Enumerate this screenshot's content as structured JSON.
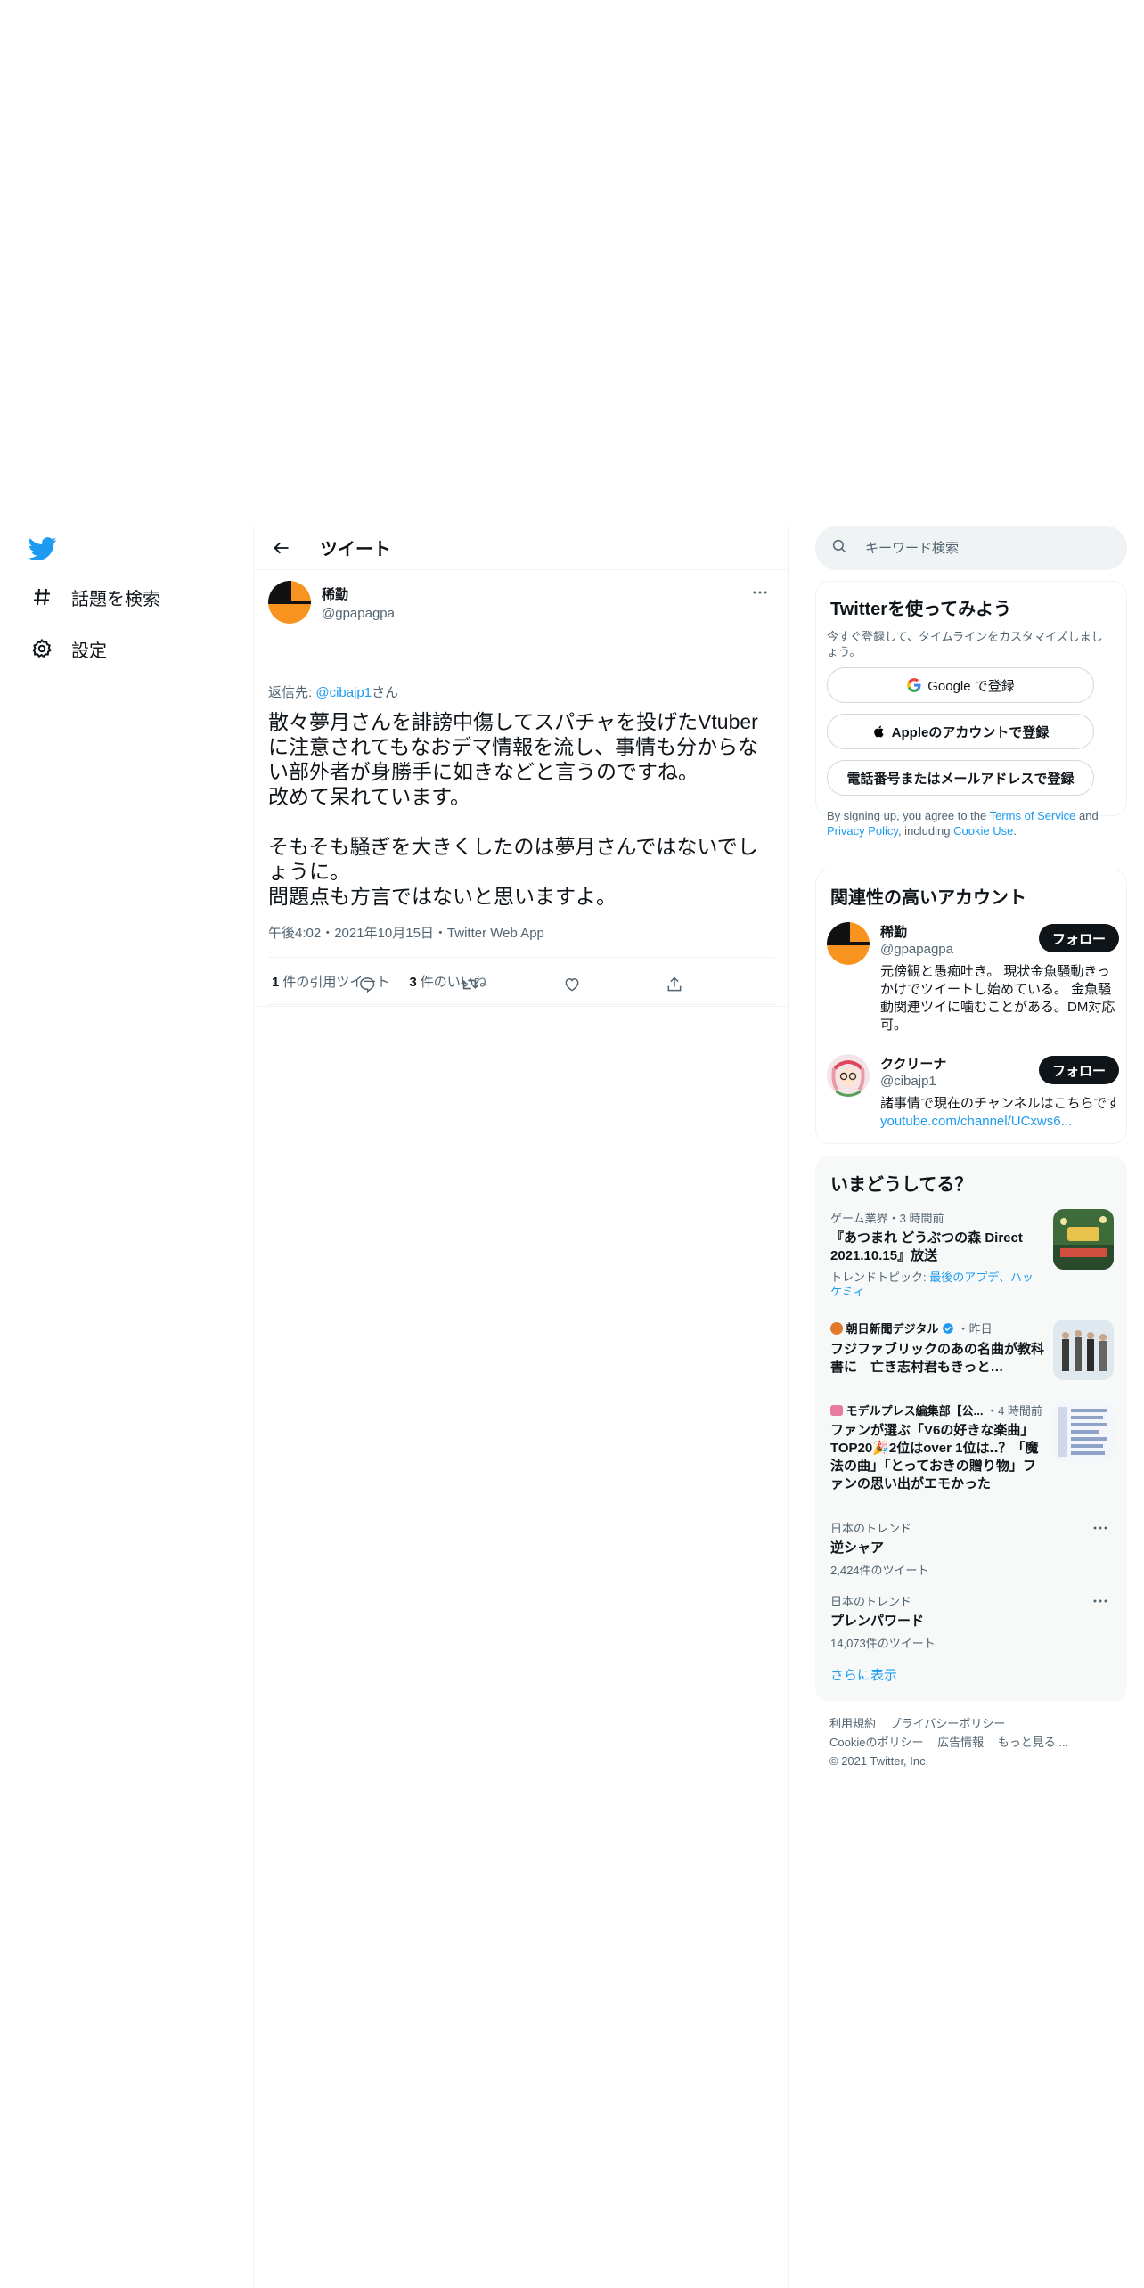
{
  "nav": {
    "items": [
      {
        "label": "話題を検索",
        "icon": "hashtag-icon"
      },
      {
        "label": "設定",
        "icon": "gear-icon"
      }
    ]
  },
  "header": {
    "title": "ツイート"
  },
  "tweet": {
    "name": "稀勤",
    "handle": "@gpapagpa",
    "reply_prefix": "返信先: ",
    "reply_to": "@cibajp1",
    "reply_suffix": "さん",
    "text": "散々夢月さんを誹謗中傷してスパチャを投げたVtuberに注意されてもなおデマ情報を流し、事情も分からない部外者が身勝手に如きなどと言うのですね。\n改めて呆れています。\n\nそもそも騒ぎを大きくしたのは夢月さんではないでしょうに。\n問題点も方言ではないと思いますよ。",
    "meta": "午後4:02・2021年10月15日・Twitter Web App",
    "quote_count": "1",
    "quote_label": "件の引用ツイート",
    "like_count": "3",
    "like_label": "件のいいね"
  },
  "search": {
    "placeholder": "キーワード検索"
  },
  "signup": {
    "title": "Twitterを使ってみよう",
    "subtitle": "今すぐ登録して、タイムラインをカスタマイズしましょう。",
    "google": "Google で登録",
    "apple": "Appleのアカウントで登録",
    "phone": "電話番号またはメールアドレスで登録",
    "legal_1": "By signing up, you agree to the ",
    "terms": "Terms of Service",
    "legal_2": " and ",
    "privacy": "Privacy Policy",
    "legal_3": ", including ",
    "cookie": "Cookie Use",
    "legal_4": "."
  },
  "relevant": {
    "title": "関連性の高いアカウント",
    "accounts": [
      {
        "name": "稀勤",
        "handle": "@gpapagpa",
        "follow": "フォロー",
        "bio": "元傍観と愚痴吐き。 現状金魚騒動きっかけでツイートし始めている。 金魚騒動関連ツイに噛むことがある。DM対応可。"
      },
      {
        "name": "ククリーナ",
        "handle": "@cibajp1",
        "follow": "フォロー",
        "bio": "諸事情で現在のチャンネルはこちらです",
        "link": "youtube.com/channel/UCxws6..."
      }
    ]
  },
  "trends": {
    "title": "いまどうしてる？",
    "items": [
      {
        "context": "ゲーム業界・3 時間前",
        "title": "『あつまれ どうぶつの森 Direct 2021.10.15』放送",
        "topic_prefix": "トレンドトピック: ",
        "topic_links": "最後のアプデ、ハッケミィ"
      },
      {
        "context_source": "朝日新聞デジタル",
        "context_time": "・昨日",
        "title": "フジファブリックのあの名曲が教科書に　亡き志村君もきっと…"
      },
      {
        "context_source": "モデルプレス編集部【公...",
        "context_time": "・4 時間前",
        "title": "ファンが選ぶ「V6の好きな楽曲」TOP20🎉2位はover 1位は‥？「魔法の曲」「とっておきの贈り物」ファンの思い出がエモかった"
      },
      {
        "context": "日本のトレンド",
        "title": "逆シャア",
        "count": "2,424件のツイート"
      },
      {
        "context": "日本のトレンド",
        "title": "プレンパワード",
        "count": "14,073件のツイート"
      }
    ],
    "show_more": "さらに表示"
  },
  "footer": {
    "links": [
      "利用規約",
      "プライバシーポリシー",
      "Cookieのポリシー",
      "広告情報",
      "もっと見る ..."
    ],
    "copyright": "© 2021 Twitter, Inc."
  },
  "colors": {
    "accent": "#1d9bf0",
    "text": "#0f1419",
    "muted": "#536471",
    "avatar_orange": "#f7931e"
  }
}
